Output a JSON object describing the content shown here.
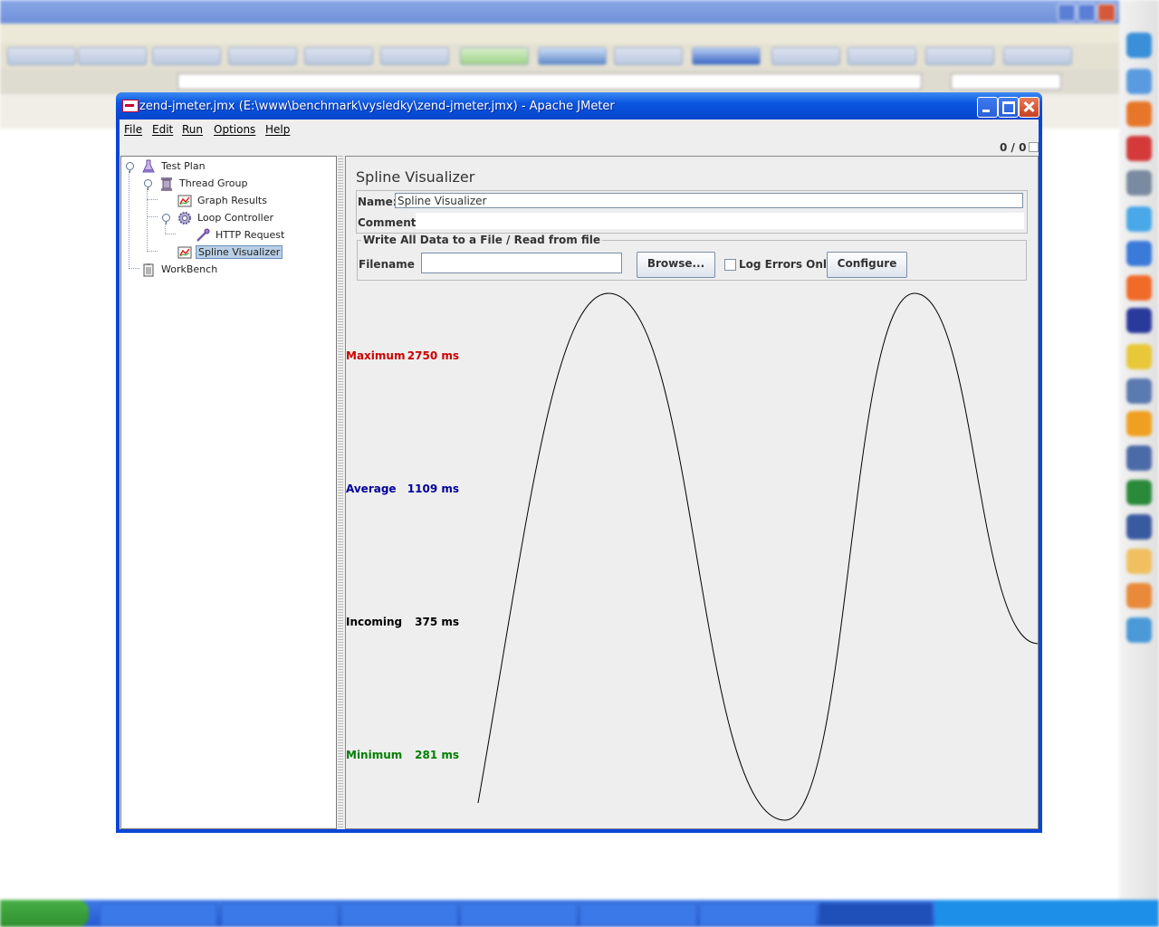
{
  "jmeter": {
    "title": "zend-jmeter.jmx (E:\\www\\benchmark\\vysledky\\zend-jmeter.jmx) - Apache JMeter",
    "menu": [
      "File",
      "Edit",
      "Run",
      "Options",
      "Help"
    ],
    "counter": "0 / 0",
    "tree": {
      "test_plan": "Test Plan",
      "thread_group": "Thread Group",
      "graph_results": "Graph Results",
      "loop_controller": "Loop Controller",
      "http_request": "HTTP Request",
      "spline_visualizer": "Spline Visualizer",
      "workbench": "WorkBench"
    },
    "panel": {
      "title": "Spline Visualizer",
      "name_label": "Name:",
      "name_value": "Spline Visualizer",
      "comments_label": "Comments:",
      "file_group_title": "Write All Data to a File / Read from file",
      "filename_label": "Filename",
      "filename_value": "",
      "browse_label": "Browse...",
      "log_errors_label": "Log Errors Only",
      "log_errors_checked": false,
      "configure_label": "Configure"
    },
    "stats": {
      "maximum": {
        "label": "Maximum",
        "value": "2750 ms",
        "color": "#cc0000"
      },
      "average": {
        "label": "Average",
        "value": "1109 ms",
        "color": "#000099"
      },
      "incoming": {
        "label": "Incoming",
        "value": "375 ms",
        "color": "#000000"
      },
      "minimum": {
        "label": "Minimum",
        "value": "281 ms",
        "color": "#008000"
      }
    },
    "spline_points_ms": [
      281,
      2750,
      281,
      2750,
      1109
    ],
    "icons": {
      "test_plan": "flask-icon",
      "thread_group": "spool-icon",
      "graph_results": "graph-icon",
      "loop_controller": "gear-icon",
      "http_request": "pipette-icon",
      "spline_visualizer": "graph-icon",
      "workbench": "clipboard-icon"
    }
  }
}
